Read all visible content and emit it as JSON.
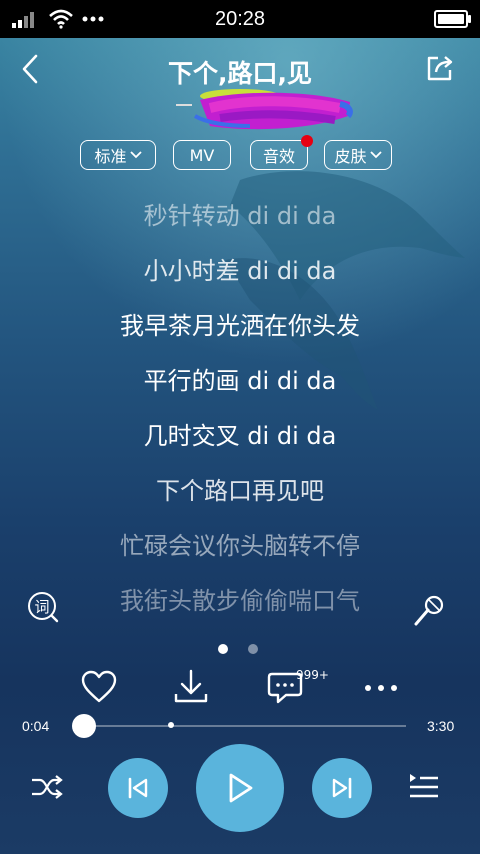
{
  "status_bar": {
    "time": "20:28"
  },
  "header": {
    "title": "下个,路口,见"
  },
  "chips": {
    "quality": "标准",
    "mv": "MV",
    "effect": "音效",
    "skin": "皮肤"
  },
  "lyrics": [
    "秒针转动 di di da",
    "小小时差 di di da",
    "我早茶月光洒在你头发",
    "平行的画 di di da",
    "几时交叉 di di da",
    "下个路口再见吧",
    "忙碌会议你头脑转不停",
    "我街头散步偷偷喘口气"
  ],
  "comments": {
    "count": "999+"
  },
  "progress": {
    "elapsed": "0:04",
    "total": "3:30",
    "played_fraction": 0.0
  },
  "pager": {
    "page_count": 2,
    "active_index": 0
  },
  "colors": {
    "accent": "#5ab4dc"
  }
}
